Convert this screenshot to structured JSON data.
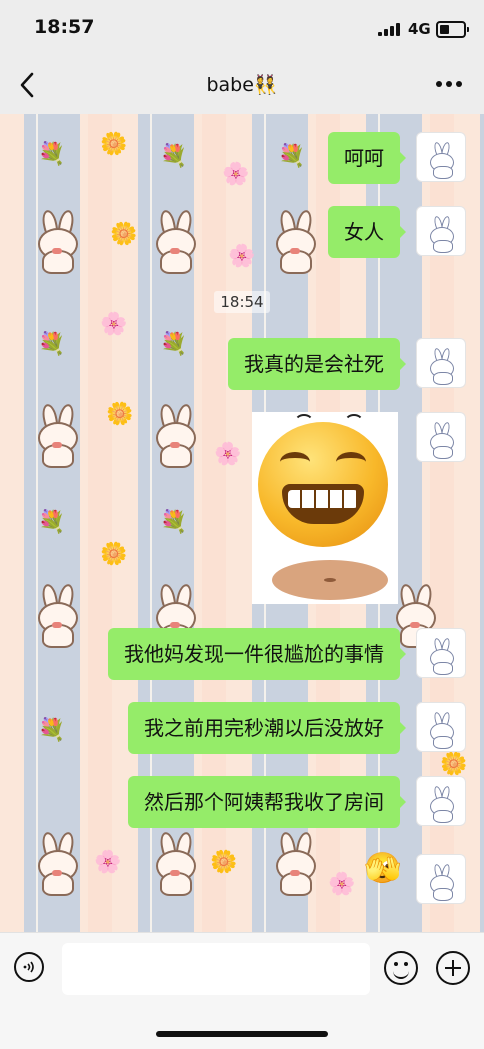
{
  "status_bar": {
    "time": "18:57",
    "network": "4G"
  },
  "nav": {
    "title": "babe👯"
  },
  "chat": {
    "timestamp": "18:54",
    "messages": [
      {
        "type": "text",
        "text": "呵呵"
      },
      {
        "type": "text",
        "text": "女人"
      },
      {
        "type": "text",
        "text": "我真的是会社死"
      },
      {
        "type": "sticker",
        "icon": "grinning-face-sticker"
      },
      {
        "type": "text",
        "text": "我他妈发现一件很尴尬的事情"
      },
      {
        "type": "text",
        "text": "我之前用完秒潮以后没放好"
      },
      {
        "type": "text",
        "text": "然后那个阿姨帮我收了房间"
      },
      {
        "type": "emoji",
        "text": "🫣"
      }
    ]
  },
  "input_bar": {
    "placeholder": "",
    "icons": [
      "voice-icon",
      "emoji-icon",
      "plus-icon"
    ]
  },
  "colors": {
    "bubble": "#95ec69",
    "bar": "#ededed"
  }
}
